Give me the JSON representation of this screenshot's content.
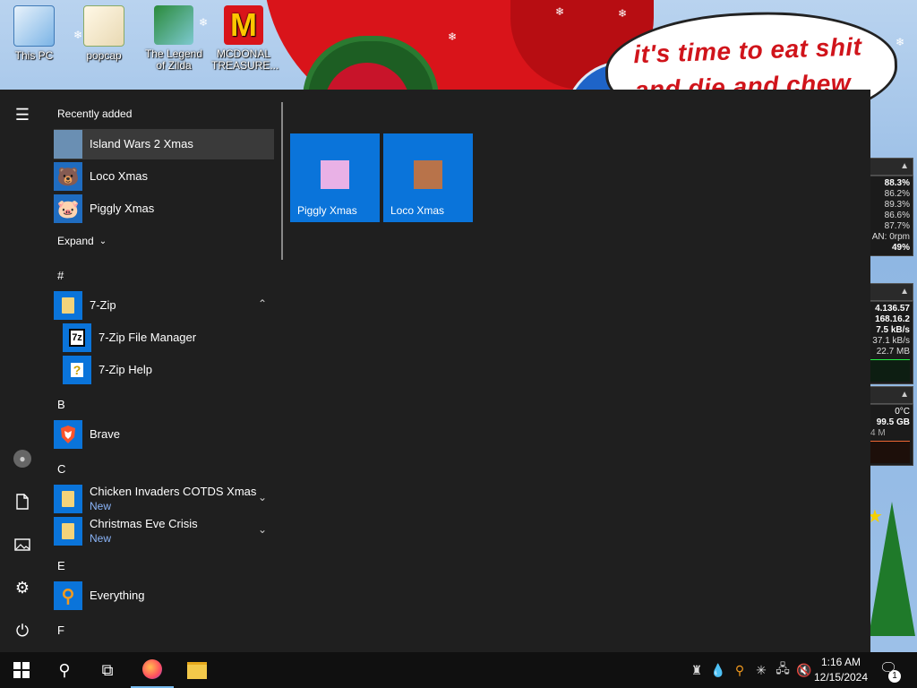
{
  "desktop": {
    "icons": [
      {
        "label": "This PC"
      },
      {
        "label": "popcap"
      },
      {
        "label": "The Legend of Zilda"
      },
      {
        "label": "MCDONAL TREASURE..."
      }
    ],
    "wallpaper_text": "it's time to eat shit and die and chew"
  },
  "widgets": {
    "cpu": [
      "88.3%",
      "86.2%",
      "89.3%",
      "86.6%",
      "87.7%",
      "AN: 0rpm",
      "49%"
    ],
    "net": [
      "4.136.57",
      "168.16.2",
      "7.5 kB/s",
      "37.1 kB/s",
      "22.7 MB"
    ],
    "disk": [
      "0°C",
      "99.5 GB",
      "4 M"
    ]
  },
  "start_menu": {
    "recently_added_header": "Recently added",
    "recent": [
      {
        "label": "Island Wars 2 Xmas"
      },
      {
        "label": "Loco Xmas"
      },
      {
        "label": "Piggly Xmas"
      }
    ],
    "expand_label": "Expand",
    "sections": {
      "hash": "#",
      "b": "B",
      "c": "C",
      "e": "E",
      "f": "F"
    },
    "apps": {
      "seven_zip": "7-Zip",
      "seven_zip_fm": "7-Zip File Manager",
      "seven_zip_help": "7-Zip Help",
      "brave": "Brave",
      "chicken": "Chicken Invaders COTDS Xmas",
      "chicken_badge": "New",
      "christmas": "Christmas Eve Crisis",
      "christmas_badge": "New",
      "everything": "Everything"
    },
    "tiles": [
      {
        "label": "Piggly Xmas"
      },
      {
        "label": "Loco Xmas"
      }
    ]
  },
  "taskbar": {
    "clock_time": "1:16 AM",
    "clock_date": "12/15/2024",
    "notification_count": "1"
  },
  "colors": {
    "accent": "#0a74da",
    "menu_bg": "#1f1f1f",
    "taskbar_bg": "#101010"
  }
}
